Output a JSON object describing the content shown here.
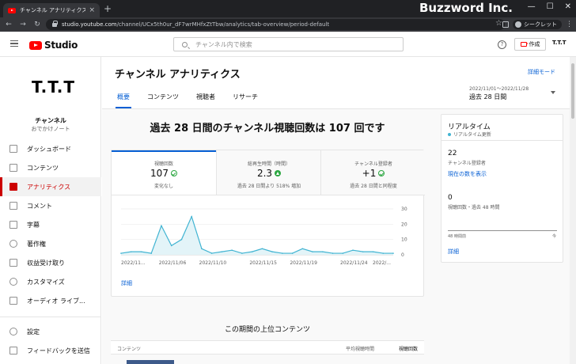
{
  "browser": {
    "tab_title": "チャンネル アナリティクス - YouTube S",
    "tab_close": "×",
    "new_tab": "+",
    "url_host": "studio.youtube.com",
    "url_path": "/channel/UCx5th0ur_dF7wrMHfxZtTbw/analytics/tab-overview/period-default",
    "incognito_label": "シークレット",
    "watermark": "Buzzword Inc.",
    "window_buttons": [
      "—",
      "☐",
      "✕"
    ]
  },
  "header": {
    "logo_text": "Studio",
    "search_placeholder": "チャンネル内で検索",
    "help": "?",
    "create_label": "作成",
    "avatar_text": "T.T.T"
  },
  "sidebar": {
    "avatar_text": "T.T.T",
    "channel_label": "チャンネル",
    "channel_name": "おでかけノート",
    "items": [
      {
        "label": "ダッシュボード",
        "icon": "dashboard-icon"
      },
      {
        "label": "コンテンツ",
        "icon": "content-icon"
      },
      {
        "label": "アナリティクス",
        "icon": "analytics-icon",
        "active": true
      },
      {
        "label": "コメント",
        "icon": "comments-icon"
      },
      {
        "label": "字幕",
        "icon": "subtitles-icon"
      },
      {
        "label": "著作権",
        "icon": "copyright-icon"
      },
      {
        "label": "収益受け取り",
        "icon": "monetization-icon"
      },
      {
        "label": "カスタマイズ",
        "icon": "customization-icon"
      },
      {
        "label": "オーディオ ライブ...",
        "icon": "audio-library-icon"
      }
    ],
    "bottom_items": [
      {
        "label": "設定",
        "icon": "settings-icon"
      },
      {
        "label": "フィードバックを送信",
        "icon": "feedback-icon"
      }
    ]
  },
  "main": {
    "title": "チャンネル アナリティクス",
    "detail_mode": "詳細モード",
    "tabs": [
      "概要",
      "コンテンツ",
      "視聴者",
      "リサーチ"
    ],
    "active_tab": 0,
    "date_range": "2022/11/01～2022/11/28",
    "date_label": "過去 28 日間",
    "headline": "過去 28 日間のチャンネル視聴回数は 107 回です",
    "metrics": [
      {
        "label": "視聴回数",
        "value": "107",
        "sub": "変化なし",
        "indicator": "check"
      },
      {
        "label": "総再生時間（時間）",
        "value": "2.3",
        "sub": "過去 28 日間より 518% 増加",
        "indicator": "up"
      },
      {
        "label": "チャンネル登録者",
        "value": "+1",
        "sub": "過去 28 日間と同程度",
        "indicator": "check"
      }
    ],
    "detail_link": "詳細",
    "section_title": "この期間の上位コンテンツ",
    "table_headers": [
      "コンテンツ",
      "平均視聴時間",
      "視聴回数"
    ]
  },
  "realtime": {
    "title": "リアルタイム",
    "subtitle": "リアルタイム更新",
    "subscribers_value": "22",
    "subscribers_label": "チャンネル登録者",
    "show_current_link": "現在の数を表示",
    "views_value": "0",
    "views_label": "視聴回数・過去 48 時間",
    "axis_left": "48 時間前",
    "axis_right": "今",
    "detail_link": "詳細"
  },
  "colors": {
    "accent": "#065fd4",
    "brand_red": "#ff0000",
    "active_red": "#cc0000",
    "chart_line": "#41b4d2",
    "chart_fill": "#e3f4f8",
    "positive": "#2ba640"
  },
  "chart_data": {
    "type": "area",
    "x": [
      "2022/11/01",
      "2022/11/02",
      "2022/11/03",
      "2022/11/04",
      "2022/11/05",
      "2022/11/06",
      "2022/11/07",
      "2022/11/08",
      "2022/11/09",
      "2022/11/10",
      "2022/11/11",
      "2022/11/12",
      "2022/11/13",
      "2022/11/14",
      "2022/11/15",
      "2022/11/16",
      "2022/11/17",
      "2022/11/18",
      "2022/11/19",
      "2022/11/20",
      "2022/11/21",
      "2022/11/22",
      "2022/11/23",
      "2022/11/24",
      "2022/11/25",
      "2022/11/26",
      "2022/11/27",
      "2022/11/28"
    ],
    "series": [
      {
        "values": [
          1,
          2,
          2,
          1,
          19,
          6,
          10,
          25,
          4,
          1,
          2,
          3,
          1,
          2,
          4,
          2,
          1,
          1,
          4,
          2,
          2,
          1,
          1,
          3,
          2,
          2,
          1,
          1
        ]
      }
    ],
    "tick_labels": [
      "2022/11...",
      "2022/11/06",
      "2022/11/10",
      "2022/11/15",
      "2022/11/19",
      "2022/11/24",
      "2022/..."
    ],
    "y_ticks": [
      "30",
      "20",
      "10",
      "0"
    ],
    "ylim": [
      0,
      30
    ]
  }
}
